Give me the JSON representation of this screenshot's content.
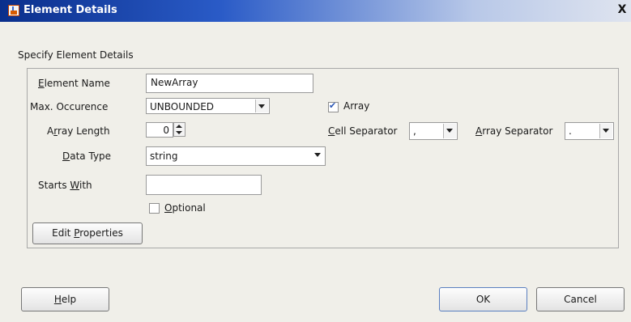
{
  "window": {
    "title": "Element Details",
    "close_glyph": "X"
  },
  "section_title": "Specify Element Details",
  "form": {
    "element_name": {
      "label": "Element Name",
      "value": "NewArray"
    },
    "max_occurence": {
      "label": "Max. Occurence",
      "value": "UNBOUNDED"
    },
    "array": {
      "label": "Array",
      "checked": true
    },
    "array_length": {
      "label": "Array Length",
      "value": "0"
    },
    "cell_separator": {
      "label": "Cell Separator",
      "value": ","
    },
    "array_separator": {
      "label": "Array Separator",
      "value": "."
    },
    "data_type": {
      "label": "Data Type",
      "value": "string"
    },
    "starts_with": {
      "label": "Starts With",
      "value": ""
    },
    "optional": {
      "label": "Optional",
      "checked": false
    },
    "edit_properties_label": "Edit Properties"
  },
  "buttons": {
    "help": "Help",
    "ok": "OK",
    "cancel": "Cancel"
  },
  "icons": {
    "window_icon": "java-cup-icon",
    "close": "close-icon",
    "dropdown": "chevron-down-icon",
    "spinner": "spinner-arrows-icon",
    "check": "checkmark-icon"
  },
  "colors": {
    "title_gradient_start": "#0a2f8c",
    "title_gradient_end": "#dfe4ef",
    "dialog_bg": "#f0efe9",
    "check": "#2b57b5"
  }
}
